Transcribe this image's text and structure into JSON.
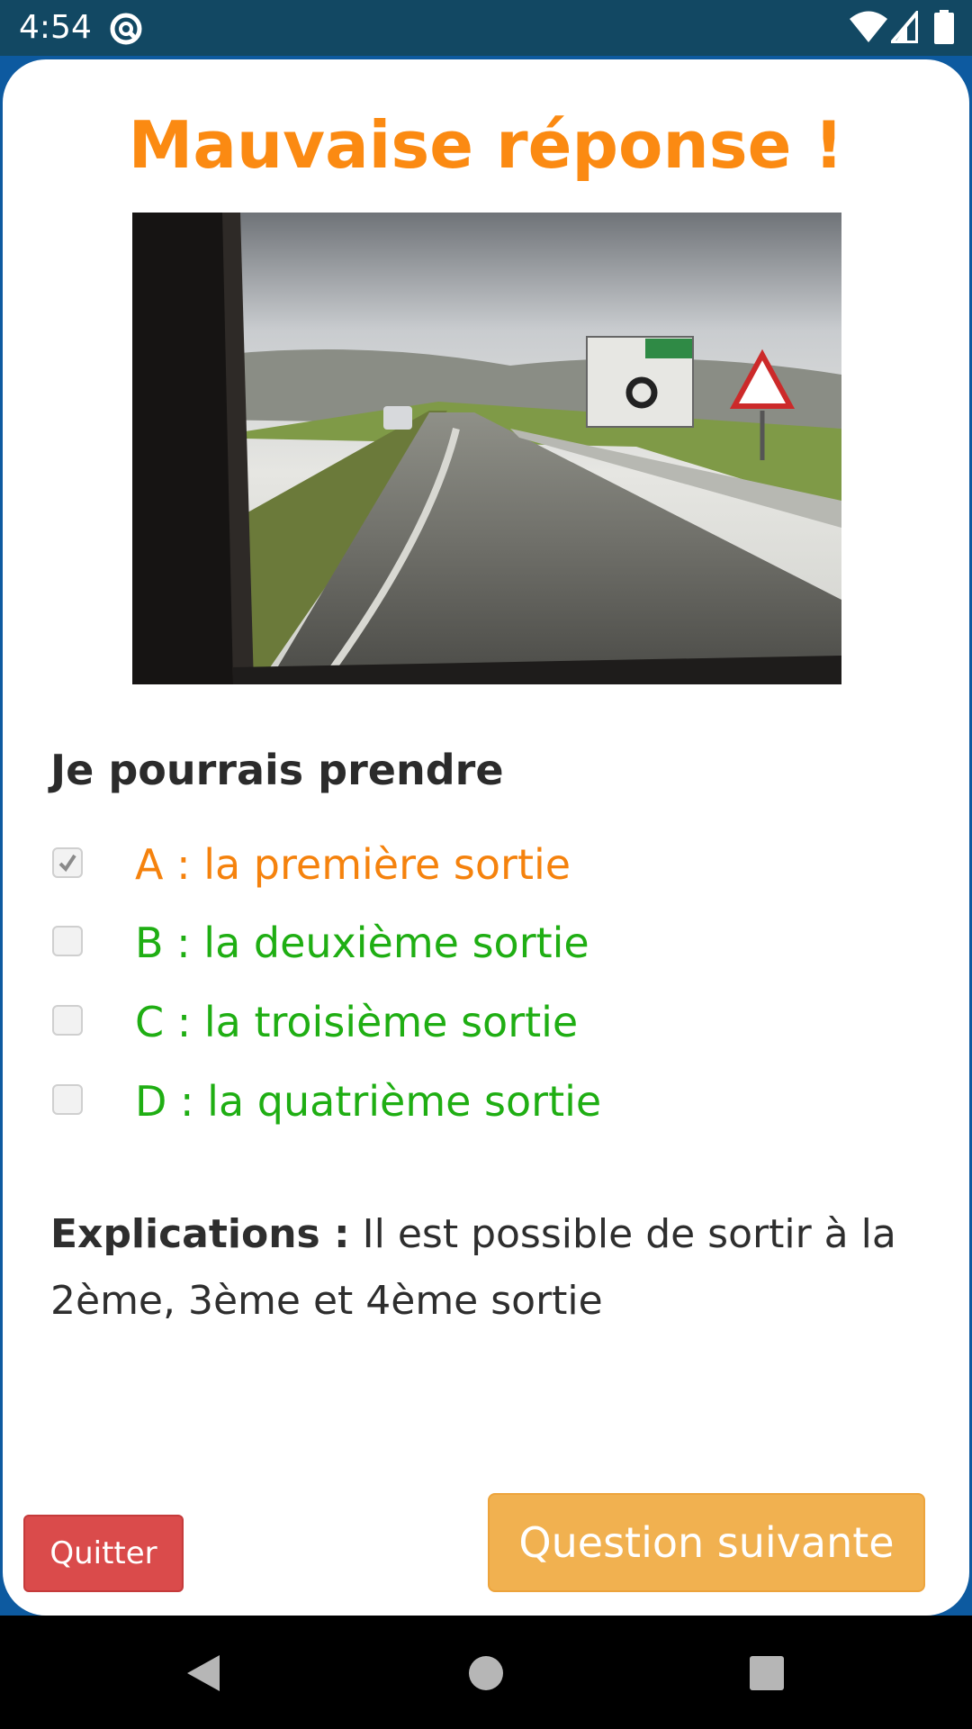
{
  "status_bar": {
    "time": "4:54",
    "icons": [
      "app-notification-icon",
      "wifi-icon",
      "signal-icon",
      "battery-icon"
    ]
  },
  "dialog": {
    "title": "Mauvaise réponse !",
    "image_description_icon": "road-roundabout-photo",
    "question": "Je pourrais prendre",
    "answers": [
      {
        "label": "A : la première sortie",
        "checked": true,
        "color": "#f5820d"
      },
      {
        "label": "B : la deuxième sortie",
        "checked": false,
        "color": "#1fae13"
      },
      {
        "label": "C : la troisième sortie",
        "checked": false,
        "color": "#1fae13"
      },
      {
        "label": "D : la quatrième sortie",
        "checked": false,
        "color": "#1fae13"
      }
    ],
    "explanation_label": "Explications :",
    "explanation_text": " Il est possible de sortir à la 2ème, 3ème et 4ème sortie",
    "quit_label": "Quitter",
    "next_label": "Question suivante"
  },
  "colors": {
    "title": "#fb8a12",
    "wrong_answer": "#f5820d",
    "correct_answer": "#1fae13",
    "quit_button": "#da4b4b",
    "next_button": "#f1b150",
    "status_bar": "#124863"
  },
  "nav_bar": {
    "icons": [
      "back-icon",
      "home-icon",
      "recents-icon"
    ]
  }
}
